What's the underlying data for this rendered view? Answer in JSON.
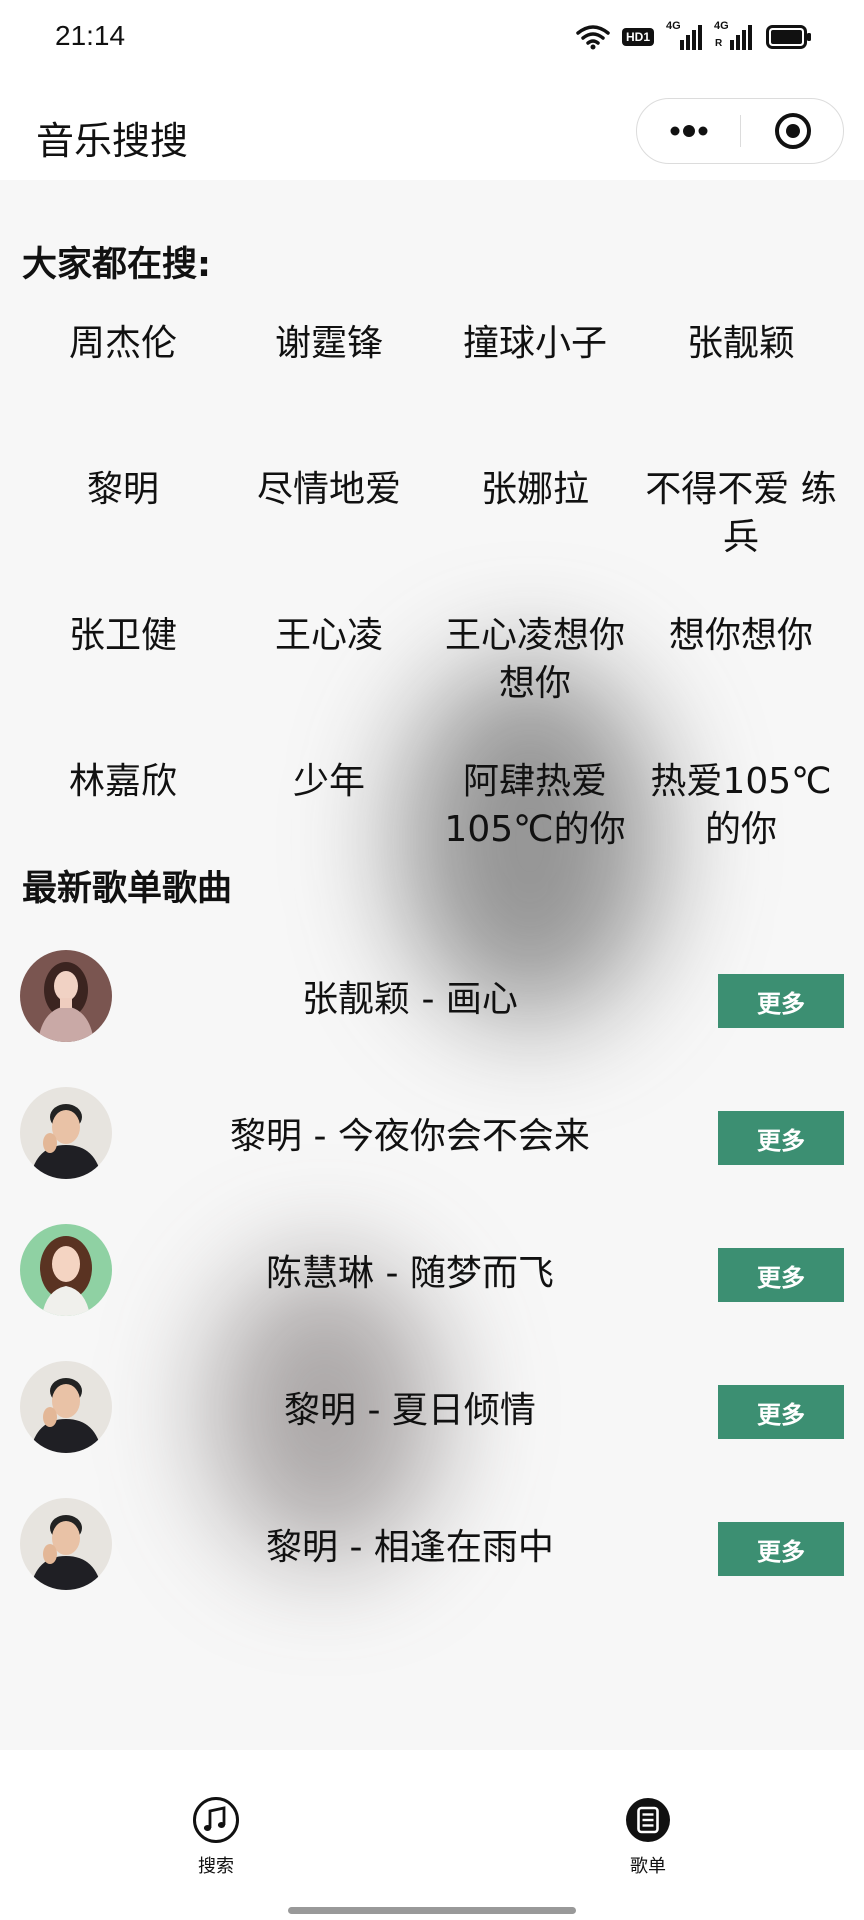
{
  "status_bar": {
    "time": "21:14",
    "hd_badge": "HD1",
    "network_1": "4G",
    "network_2": "4G",
    "roaming": "R",
    "icons": [
      "wifi-icon",
      "hd-icon",
      "signal-icon",
      "signal-icon",
      "battery-icon"
    ]
  },
  "nav": {
    "title": "音乐搜搜",
    "capsule_icons": [
      "more-dots-icon",
      "target-close-icon"
    ]
  },
  "hot": {
    "title": "大家都在搜:",
    "items": [
      "周杰伦",
      "谢霆锋",
      "撞球小子",
      "张靓颖",
      "黎明",
      "尽情地爱",
      "张娜拉",
      "不得不爱 练兵",
      "张卫健",
      "王心凌",
      "王心凌想你想你",
      "想你想你",
      "林嘉欣",
      "少年",
      "阿肆热爱105℃的你",
      "热爱105℃的你"
    ]
  },
  "new_songs": {
    "title": "最新歌单歌曲",
    "more_label": "更多",
    "items": [
      {
        "text": "张靓颖 - 画心"
      },
      {
        "text": "黎明 - 今夜你会不会来"
      },
      {
        "text": "陈慧琳 - 随梦而飞"
      },
      {
        "text": "黎明 - 夏日倾情"
      },
      {
        "text": "黎明 - 相逢在雨中"
      }
    ]
  },
  "tabs": [
    {
      "label": "搜索",
      "icon": "music-note-icon"
    },
    {
      "label": "歌单",
      "icon": "list-icon"
    }
  ],
  "colors": {
    "accent": "#3c8f72",
    "background": "#f7f7f7"
  }
}
